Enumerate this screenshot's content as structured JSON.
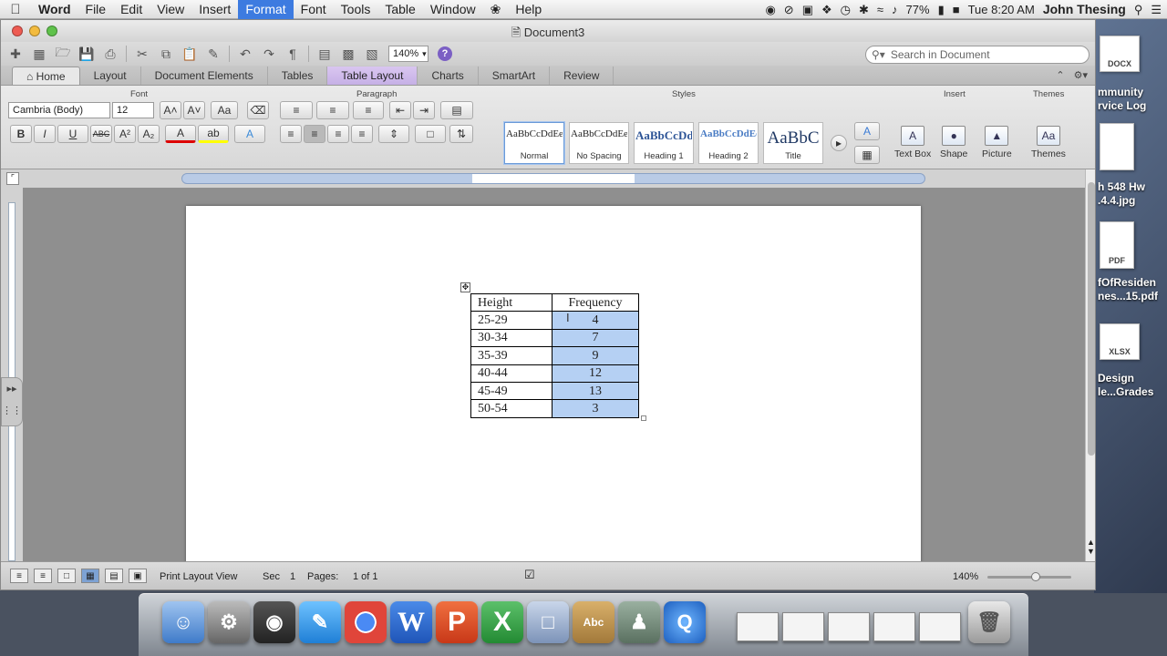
{
  "menubar": {
    "apple": "",
    "items": [
      "Word",
      "File",
      "Edit",
      "View",
      "Insert",
      "Format",
      "Font",
      "Tools",
      "Table",
      "Window",
      "Help"
    ],
    "active_item": "Format",
    "battery": "77%",
    "clock": "Tue 8:20 AM",
    "user": "John Thesing"
  },
  "window": {
    "title": "Document3",
    "zoom": "140%",
    "search_placeholder": "Search in Document"
  },
  "tabs": [
    "Home",
    "Layout",
    "Document Elements",
    "Tables",
    "Table Layout",
    "Charts",
    "SmartArt",
    "Review"
  ],
  "ribbon": {
    "groups": {
      "font": "Font",
      "paragraph": "Paragraph",
      "styles": "Styles",
      "insert": "Insert",
      "themes": "Themes"
    },
    "font_name": "Cambria (Body)",
    "font_size": "12",
    "styles": [
      {
        "preview": "AaBbCcDdEe",
        "name": "Normal"
      },
      {
        "preview": "AaBbCcDdEe",
        "name": "No Spacing"
      },
      {
        "preview": "AaBbCcDd",
        "name": "Heading 1"
      },
      {
        "preview": "AaBbCcDdEe",
        "name": "Heading 2"
      },
      {
        "preview": "AaBbC",
        "name": "Title"
      }
    ],
    "insert": [
      "Text Box",
      "Shape",
      "Picture"
    ],
    "themes": "Themes"
  },
  "document": {
    "table": {
      "headers": [
        "Height",
        "Frequency"
      ],
      "rows": [
        [
          "25-29",
          "4"
        ],
        [
          "30-34",
          "7"
        ],
        [
          "35-39",
          "9"
        ],
        [
          "40-44",
          "12"
        ],
        [
          "45-49",
          "13"
        ],
        [
          "50-54",
          "3"
        ]
      ]
    }
  },
  "statusbar": {
    "view": "Print Layout View",
    "sec_label": "Sec",
    "sec": "1",
    "pages_label": "Pages:",
    "pages": "1 of 1",
    "zoom": "140%"
  },
  "desktop": {
    "files": [
      {
        "badge": "DOCX",
        "label1": "mmunity",
        "label2": "rvice Log"
      },
      {
        "badge": "",
        "label1": "h 548 Hw",
        "label2": ".4.4.jpg"
      },
      {
        "badge": "PDF",
        "label1": "fOfResiden",
        "label2": "nes...15.pdf"
      },
      {
        "badge": "XLSX",
        "label1": "Design",
        "label2": "le...Grades"
      }
    ]
  }
}
